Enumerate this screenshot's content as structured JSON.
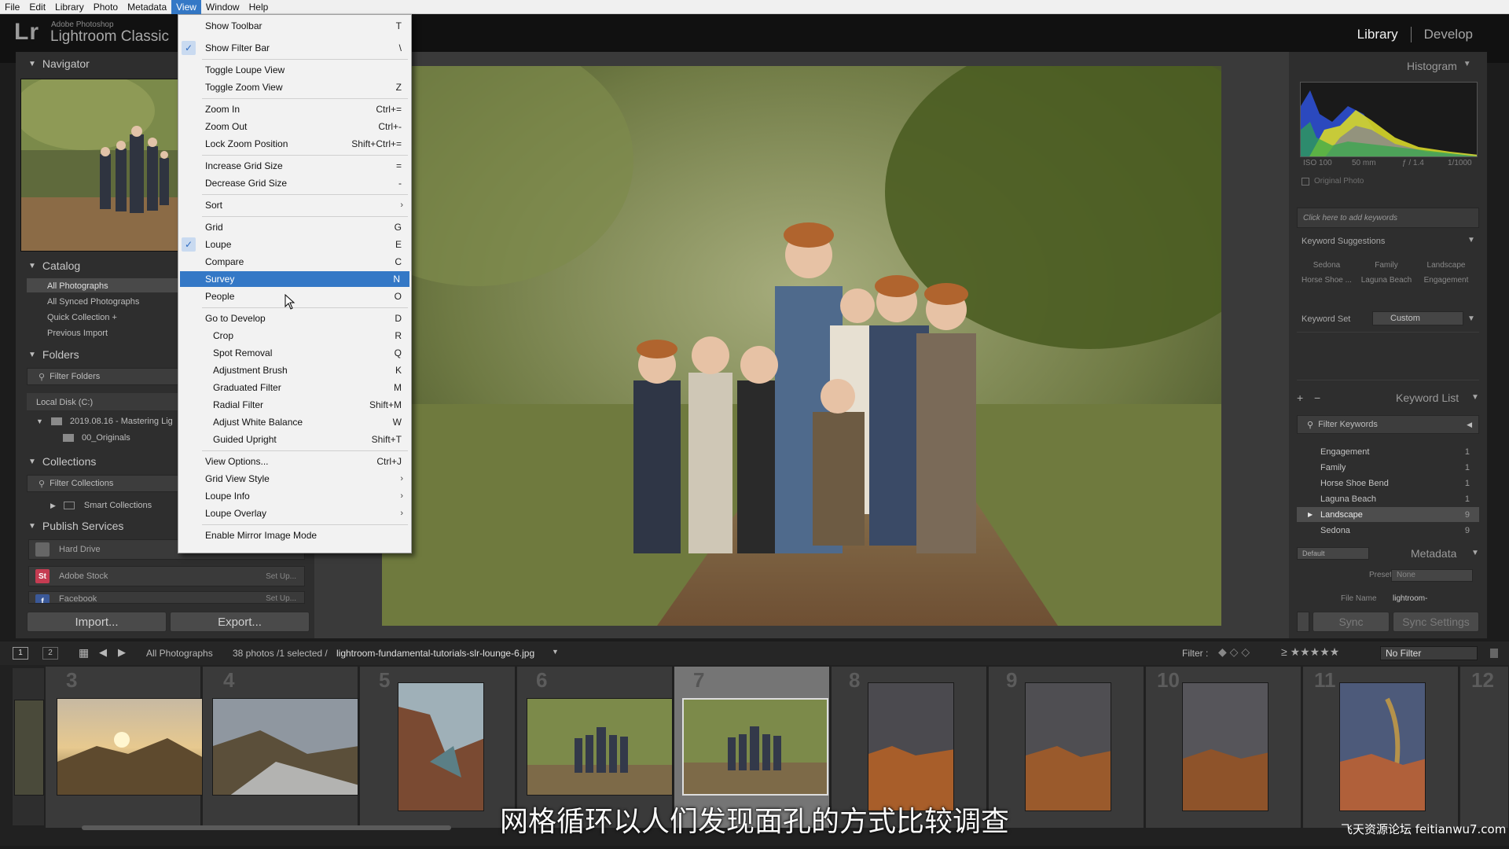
{
  "menubar": [
    "File",
    "Edit",
    "Library",
    "Photo",
    "Metadata",
    "View",
    "Window",
    "Help"
  ],
  "brand": {
    "small": "Adobe Photoshop",
    "big": "Lightroom Classic",
    "logo": "Lr"
  },
  "modules": {
    "library": "Library",
    "develop": "Develop"
  },
  "left": {
    "navigator": "Navigator",
    "catalog": "Catalog",
    "catalog_items": [
      "All Photographs",
      "All Synced Photographs",
      "Quick Collection +",
      "Previous Import"
    ],
    "folders": "Folders",
    "filter_folders": "Filter Folders",
    "local_disk": "Local Disk (C:)",
    "folder1": "2019.08.16 - Mastering Lig",
    "folder2": "00_Originals",
    "collections": "Collections",
    "filter_collections": "Filter Collections",
    "smart_collections": "Smart Collections",
    "publish": "Publish Services",
    "pub": [
      {
        "name": "Hard Drive",
        "action": ""
      },
      {
        "name": "Adobe Stock",
        "action": "Set Up..."
      },
      {
        "name": "Facebook",
        "action": "Set Up..."
      }
    ],
    "import": "Import...",
    "export": "Export..."
  },
  "viewmenu": {
    "items": [
      {
        "label": "Show Toolbar",
        "sc": "T"
      },
      {
        "label": "Show Filter Bar",
        "sc": "\\",
        "checked": true
      },
      {
        "label": "Toggle Loupe View",
        "sc": ""
      },
      {
        "label": "Toggle Zoom View",
        "sc": "Z"
      },
      {
        "label": "Zoom In",
        "sc": "Ctrl+="
      },
      {
        "label": "Zoom Out",
        "sc": "Ctrl+-"
      },
      {
        "label": "Lock Zoom Position",
        "sc": "Shift+Ctrl+="
      },
      {
        "label": "Increase Grid Size",
        "sc": "="
      },
      {
        "label": "Decrease Grid Size",
        "sc": "-"
      },
      {
        "label": "Sort",
        "sc": ""
      },
      {
        "label": "Grid",
        "sc": "G"
      },
      {
        "label": "Loupe",
        "sc": "E",
        "checked": true
      },
      {
        "label": "Compare",
        "sc": "C"
      },
      {
        "label": "Survey",
        "sc": "N",
        "highlight": true
      },
      {
        "label": "People",
        "sc": "O"
      },
      {
        "label": "Go to Develop",
        "sc": "D"
      },
      {
        "label": "Crop",
        "sc": "R"
      },
      {
        "label": "Spot Removal",
        "sc": "Q"
      },
      {
        "label": "Adjustment Brush",
        "sc": "K"
      },
      {
        "label": "Graduated Filter",
        "sc": "M"
      },
      {
        "label": "Radial Filter",
        "sc": "Shift+M"
      },
      {
        "label": "Adjust White Balance",
        "sc": "W"
      },
      {
        "label": "Guided Upright",
        "sc": "Shift+T"
      },
      {
        "label": "View Options...",
        "sc": "Ctrl+J"
      },
      {
        "label": "Grid View Style",
        "sc": ""
      },
      {
        "label": "Loupe Info",
        "sc": ""
      },
      {
        "label": "Loupe Overlay",
        "sc": ""
      },
      {
        "label": "Enable Mirror Image Mode",
        "sc": ""
      }
    ]
  },
  "right": {
    "histogram": "Histogram",
    "iso": "ISO 100",
    "focal": "50 mm",
    "aperture": "ƒ / 1.4",
    "shutter": "1/1000",
    "original_photo": "Original Photo",
    "add_keywords": "Click here to add keywords",
    "kw_suggestions": "Keyword Suggestions",
    "sugg": [
      "Sedona",
      "Family",
      "Landscape",
      "Horse Shoe ...",
      "Laguna Beach",
      "Engagement"
    ],
    "kw_set": "Keyword Set",
    "kw_set_value": "Custom",
    "keyword_list": "Keyword List",
    "filter_keywords": "Filter Keywords",
    "keywords": [
      {
        "name": "Engagement",
        "count": "1"
      },
      {
        "name": "Family",
        "count": "1"
      },
      {
        "name": "Horse Shoe Bend",
        "count": "1"
      },
      {
        "name": "Laguna Beach",
        "count": "1"
      },
      {
        "name": "Landscape",
        "count": "9",
        "selected": true
      },
      {
        "name": "Sedona",
        "count": "9"
      }
    ],
    "default": "Default",
    "metadata": "Metadata",
    "preset_label": "Preset",
    "preset_value": "None",
    "filename_label": "File Name",
    "filename_value": "lightroom-",
    "sync": "Sync",
    "sync_settings": "Sync Settings"
  },
  "filmstrip_bar": {
    "screen1": "1",
    "screen2": "2",
    "source": "All Photographs",
    "count": "38 photos /1 selected /",
    "filename": "lightroom-fundamental-tutorials-slr-lounge-6.jpg",
    "filter_label": "Filter :",
    "no_filter": "No Filter"
  },
  "filmstrip": {
    "cells": [
      {
        "num": "3"
      },
      {
        "num": "4"
      },
      {
        "num": "5"
      },
      {
        "num": "6"
      },
      {
        "num": "7",
        "selected": true
      },
      {
        "num": "8"
      },
      {
        "num": "9"
      },
      {
        "num": "10"
      },
      {
        "num": "11"
      },
      {
        "num": "12"
      }
    ]
  },
  "subtitle": "网格循环以人们发现面孔的方式比较调查",
  "watermark": "飞天资源论坛 feitianwu7.com"
}
